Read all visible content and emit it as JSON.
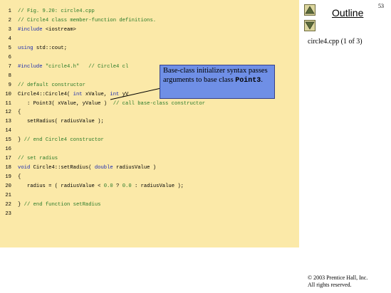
{
  "page_number": "53",
  "outline_title": "Outline",
  "file_info": "circle4.cpp (1 of 3)",
  "copyright_line1": "© 2003 Prentice Hall, Inc.",
  "copyright_line2": "All rights reserved.",
  "callout": {
    "text": "Base-class initializer syntax passes arguments to base class ",
    "code": "Point3",
    "suffix": "."
  },
  "code_lines": [
    {
      "num": "1",
      "tokens": [
        {
          "t": "// Fig. 9.20: circle4.cpp",
          "c": "comment"
        }
      ]
    },
    {
      "num": "2",
      "tokens": [
        {
          "t": "// Circle4 class member-function definitions.",
          "c": "comment"
        }
      ]
    },
    {
      "num": "3",
      "tokens": [
        {
          "t": "#include",
          "c": "kw"
        },
        {
          "t": " <iostream>",
          "c": "plain"
        }
      ]
    },
    {
      "num": "4",
      "tokens": []
    },
    {
      "num": "5",
      "tokens": [
        {
          "t": "using",
          "c": "kw"
        },
        {
          "t": " std::cout;",
          "c": "plain"
        }
      ]
    },
    {
      "num": "6",
      "tokens": []
    },
    {
      "num": "7",
      "tokens": [
        {
          "t": "#include",
          "c": "kw"
        },
        {
          "t": " ",
          "c": "plain"
        },
        {
          "t": "\"circle4.h\"",
          "c": "str"
        },
        {
          "t": "   // Circle4 cl",
          "c": "comment"
        }
      ]
    },
    {
      "num": "8",
      "tokens": []
    },
    {
      "num": "9",
      "tokens": [
        {
          "t": "// default constructor",
          "c": "comment"
        }
      ]
    },
    {
      "num": "10",
      "tokens": [
        {
          "t": "Circle4::Circle4( ",
          "c": "plain"
        },
        {
          "t": "int",
          "c": "kw"
        },
        {
          "t": " xValue, ",
          "c": "plain"
        },
        {
          "t": "int",
          "c": "kw"
        },
        {
          "t": " yV",
          "c": "plain"
        }
      ]
    },
    {
      "num": "11",
      "tokens": [
        {
          "t": "   : Point3( xValue, yValue )  ",
          "c": "plain"
        },
        {
          "t": "// call base-class constructor",
          "c": "comment"
        }
      ]
    },
    {
      "num": "12",
      "tokens": [
        {
          "t": "{",
          "c": "plain"
        }
      ]
    },
    {
      "num": "13",
      "tokens": [
        {
          "t": "   setRadius( radiusValue );",
          "c": "plain"
        }
      ]
    },
    {
      "num": "14",
      "tokens": []
    },
    {
      "num": "15",
      "tokens": [
        {
          "t": "} ",
          "c": "plain"
        },
        {
          "t": "// end Circle4 constructor",
          "c": "comment"
        }
      ]
    },
    {
      "num": "16",
      "tokens": []
    },
    {
      "num": "17",
      "tokens": [
        {
          "t": "// set radius",
          "c": "comment"
        }
      ]
    },
    {
      "num": "18",
      "tokens": [
        {
          "t": "void",
          "c": "kw"
        },
        {
          "t": " Circle4::setRadius( ",
          "c": "plain"
        },
        {
          "t": "double",
          "c": "kw"
        },
        {
          "t": " radiusValue )",
          "c": "plain"
        }
      ]
    },
    {
      "num": "19",
      "tokens": [
        {
          "t": "{",
          "c": "plain"
        }
      ]
    },
    {
      "num": "20",
      "tokens": [
        {
          "t": "   radius = ( radiusValue < ",
          "c": "plain"
        },
        {
          "t": "0.0",
          "c": "num"
        },
        {
          "t": " ? ",
          "c": "plain"
        },
        {
          "t": "0.0",
          "c": "num"
        },
        {
          "t": " : radiusValue );",
          "c": "plain"
        }
      ]
    },
    {
      "num": "21",
      "tokens": []
    },
    {
      "num": "22",
      "tokens": [
        {
          "t": "} ",
          "c": "plain"
        },
        {
          "t": "// end function setRadius",
          "c": "comment"
        }
      ]
    },
    {
      "num": "23",
      "tokens": []
    }
  ]
}
